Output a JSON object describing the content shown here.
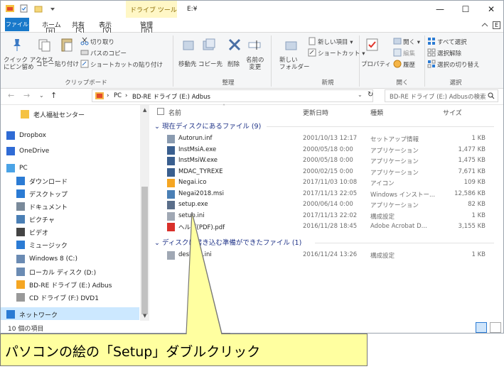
{
  "window": {
    "title": "E:¥",
    "context_tab": "ドライブ ツール",
    "controls": {
      "minimize": "—",
      "maximize": "☐",
      "close": "✕"
    }
  },
  "ribbon_tabs": [
    {
      "label": "ファイル",
      "key": "F"
    },
    {
      "label": "ホーム",
      "key": "H"
    },
    {
      "label": "共有",
      "key": "S"
    },
    {
      "label": "表示",
      "key": "V"
    },
    {
      "label": "管理",
      "key": "JD"
    }
  ],
  "ribbon": {
    "clipboard": {
      "quick_access": "クイック アクセス\nにピン留め",
      "copy": "コピー",
      "paste": "貼り付け",
      "cut": "切り取り",
      "copy_path": "パスのコピー",
      "paste_shortcut": "ショートカットの貼り付け",
      "group": "クリップボード"
    },
    "organize": {
      "move": "移動先",
      "copyto": "コピー先",
      "delete": "削除",
      "rename": "名前の\n変更",
      "group": "整理"
    },
    "new": {
      "new_folder": "新しい\nフォルダー",
      "new_item": "新しい項目 ▾",
      "shortcut": "ショートカット ▾",
      "group": "新規"
    },
    "open": {
      "properties": "プロパティ",
      "open": "開く ▾",
      "edit": "編集",
      "history": "履歴",
      "group": "開く"
    },
    "select": {
      "select_all": "すべて選択",
      "select_none": "選択解除",
      "invert": "選択の切り替え",
      "group": "選択"
    }
  },
  "address": {
    "path": [
      "PC",
      "BD-RE ドライブ (E:) Adbus"
    ],
    "search_placeholder": "BD-RE ドライブ (E:) Adbusの検索"
  },
  "nav_items": [
    {
      "label": "老人福祉センター",
      "icon": "folder-icon"
    },
    {
      "label": "Dropbox",
      "icon": "dropbox-icon"
    },
    {
      "label": "OneDrive",
      "icon": "onedrive-icon"
    },
    {
      "label": "PC",
      "icon": "pc-icon"
    },
    {
      "label": "ダウンロード",
      "icon": "download-icon"
    },
    {
      "label": "デスクトップ",
      "icon": "desktop-icon"
    },
    {
      "label": "ドキュメント",
      "icon": "document-icon"
    },
    {
      "label": "ピクチャ",
      "icon": "picture-icon"
    },
    {
      "label": "ビデオ",
      "icon": "video-icon"
    },
    {
      "label": "ミュージック",
      "icon": "music-icon"
    },
    {
      "label": "Windows 8 (C:)",
      "icon": "drive-icon"
    },
    {
      "label": "ローカル ディスク (D:)",
      "icon": "drive-icon"
    },
    {
      "label": "BD-RE ドライブ (E:) Adbus",
      "icon": "disc-icon"
    },
    {
      "label": "CD ドライブ (F:) DVD1",
      "icon": "cd-icon"
    },
    {
      "label": "ネットワーク",
      "icon": "network-icon"
    }
  ],
  "columns": {
    "name": "名前",
    "date": "更新日時",
    "type": "種類",
    "size": "サイズ"
  },
  "groups": [
    {
      "title": "現在ディスクにあるファイル (9)",
      "files": [
        {
          "name": "Autorun.inf",
          "date": "2001/10/13 12:17",
          "type": "セットアップ情報",
          "size": "1 KB",
          "icon": "inf-icon"
        },
        {
          "name": "InstMsiA.exe",
          "date": "2000/05/18 0:00",
          "type": "アプリケーション",
          "size": "1,477 KB",
          "icon": "exe-icon"
        },
        {
          "name": "InstMsiW.exe",
          "date": "2000/05/18 0:00",
          "type": "アプリケーション",
          "size": "1,475 KB",
          "icon": "exe-icon"
        },
        {
          "name": "MDAC_TYREXE",
          "date": "2000/02/15 0:00",
          "type": "アプリケーション",
          "size": "7,671 KB",
          "icon": "exe-icon"
        },
        {
          "name": "Negai.ico",
          "date": "2017/11/03 10:08",
          "type": "アイコン",
          "size": "109 KB",
          "icon": "ico-icon"
        },
        {
          "name": "Negai2018.msi",
          "date": "2017/11/13 22:05",
          "type": "Windows インストー...",
          "size": "12,586 KB",
          "icon": "msi-icon"
        },
        {
          "name": "setup.exe",
          "date": "2000/06/14 0:00",
          "type": "アプリケーション",
          "size": "82 KB",
          "icon": "setup-icon"
        },
        {
          "name": "setup.ini",
          "date": "2017/11/13 22:02",
          "type": "構成設定",
          "size": "1 KB",
          "icon": "ini-icon"
        },
        {
          "name": "ヘルプ(PDF).pdf",
          "date": "2016/11/28 18:45",
          "type": "Adobe Acrobat D...",
          "size": "3,155 KB",
          "icon": "pdf-icon"
        }
      ]
    },
    {
      "title": "ディスクに書き込む準備ができたファイル (1)",
      "files": [
        {
          "name": "desktop.ini",
          "date": "2016/11/24 13:26",
          "type": "構成設定",
          "size": "1 KB",
          "icon": "ini-icon"
        }
      ]
    }
  ],
  "status": {
    "count": "10 個の項目"
  },
  "callout": {
    "text": "パソコンの絵の「Setup」ダブルクリック"
  },
  "colors": {
    "accent": "#1979ca",
    "callout_bg": "#ffffa0",
    "group_title": "#1e3287"
  }
}
